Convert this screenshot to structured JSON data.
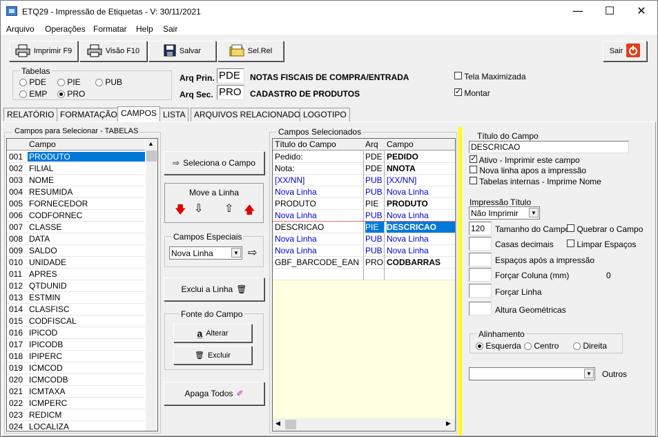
{
  "window": {
    "title": "ETQ29 - Impressão de Etiquetas - V: 30/11/2021",
    "minimize": "—",
    "maximize": "☐",
    "close": "✕"
  },
  "menu": [
    "Arquivo",
    "Operações",
    "Formatar",
    "Help",
    "Sair"
  ],
  "toolbar": {
    "print": "Imprimir F9",
    "preview": "Visão F10",
    "save": "Salvar",
    "selrel": "Sel.Rel",
    "exit": "Sair"
  },
  "tabelas": {
    "label": "Tabelas",
    "options": [
      "PDE",
      "PIE",
      "PUB",
      "EMP",
      "PRO"
    ],
    "selected": "PRO"
  },
  "arq": {
    "prin_label": "Arq Prin.",
    "prin_code": "PDE",
    "prin_desc": "NOTAS FISCAIS DE COMPRA/ENTRADA",
    "sec_label": "Arq Sec.",
    "sec_code": "PRO",
    "sec_desc": "CADASTRO DE PRODUTOS"
  },
  "options": {
    "maximized": "Tela Maximizada",
    "maximized_checked": false,
    "mount": "Montar",
    "mount_checked": true
  },
  "tabs": [
    "RELATÓRIO",
    "FORMATAÇÃO",
    "CAMPOS",
    "LISTA",
    "ARQUIVOS RELACIONADOS",
    "LOGOTIPO"
  ],
  "active_tab": "CAMPOS",
  "left_panel": {
    "title": "Campos para Selecionar  - TABELAS",
    "header": "Campo",
    "rows": [
      [
        "001",
        "PRODUTO"
      ],
      [
        "002",
        "FILIAL"
      ],
      [
        "003",
        "NOME"
      ],
      [
        "004",
        "RESUMIDA"
      ],
      [
        "005",
        "FORNECEDOR"
      ],
      [
        "006",
        "CODFORNEC"
      ],
      [
        "007",
        "CLASSE"
      ],
      [
        "008",
        "DATA"
      ],
      [
        "009",
        "SALDO"
      ],
      [
        "010",
        "UNIDADE"
      ],
      [
        "011",
        "APRES"
      ],
      [
        "012",
        "QTDUNID"
      ],
      [
        "013",
        "ESTMIN"
      ],
      [
        "014",
        "CLASFISC"
      ],
      [
        "015",
        "CODFISCAL"
      ],
      [
        "016",
        "IPICOD"
      ],
      [
        "017",
        "IPICODB"
      ],
      [
        "018",
        "IPIPERC"
      ],
      [
        "019",
        "ICMCOD"
      ],
      [
        "020",
        "ICMCODB"
      ],
      [
        "021",
        "ICMTAXA"
      ],
      [
        "022",
        "ICMPERC"
      ],
      [
        "023",
        "REDICM"
      ],
      [
        "024",
        "LOCALIZA"
      ]
    ],
    "selected_row": 0
  },
  "middle": {
    "select_field": "Seleciona o Campo",
    "move_line": "Move a Linha",
    "special": "Campos Especiais",
    "special_value": "Nova Linha",
    "delete_line": "Exclui a Linha",
    "font": "Fonte do Campo",
    "alter": "Alterar",
    "exclude": "Excluir",
    "clear_all": "Apaga Todos"
  },
  "selected_panel": {
    "title": "Campos Selecionados",
    "headers": [
      "Título do Campo",
      "Arq",
      "Campo"
    ],
    "rows": [
      [
        "Pedido:",
        "PDE",
        "PEDIDO",
        "normal"
      ],
      [
        "Nota:",
        "PDE",
        "NNOTA",
        "normal"
      ],
      [
        "[XX/NN]",
        "PUB",
        "[XX/NN]",
        "blue"
      ],
      [
        "Nova Linha",
        "PUB",
        "Nova Linha",
        "blue"
      ],
      [
        "PRODUTO",
        "PIE",
        "PRODUTO",
        "normal"
      ],
      [
        "Nova Linha",
        "PUB",
        "Nova Linha",
        "blue"
      ],
      [
        "DESCRICAO",
        "PIE",
        "DESCRICAO",
        "sel"
      ],
      [
        "Nova Linha",
        "PUB",
        "Nova Linha",
        "blue"
      ],
      [
        "Nova Linha",
        "PUB",
        "Nova Linha",
        "blue"
      ],
      [
        "GBF_BARCODE_EAN",
        "PRO",
        "CODBARRAS",
        "normal"
      ],
      [
        "",
        "",
        "",
        " "
      ]
    ]
  },
  "props": {
    "title_label": "Título do Campo",
    "title_value": "DESCRICAO",
    "active": "Ativo - Imprimir este campo",
    "active_checked": true,
    "newline": "Nova linha apos a impressão",
    "newline_checked": false,
    "internal": "Tabelas internas - Imprime Nome",
    "internal_checked": false,
    "print_title": "Impressão Título",
    "print_title_value": "Não Imprimir",
    "size_value": "120",
    "size_label": "Tamanho do Campo",
    "break_label": "Quebrar o Campo",
    "decimals_label": "Casas decimais",
    "clear_spaces": "Limpar Espaços",
    "spaces_after": "Espaços após a impressão",
    "force_col": "Forçar Coluna (mm)",
    "force_col_value": "0",
    "force_line": "Forçar Linha",
    "geo_height": "Altura Geométricas",
    "align_label": "Alinhamento",
    "align_options": [
      "Esquerda",
      "Centro",
      "Direita"
    ],
    "align_selected": "Esquerda",
    "others": "Outros"
  },
  "colors": {
    "selection": "#0078d7",
    "highlight_bar": "#ffff00",
    "grid_bg": "#ffffe1",
    "exit_red": "#e0401c"
  }
}
